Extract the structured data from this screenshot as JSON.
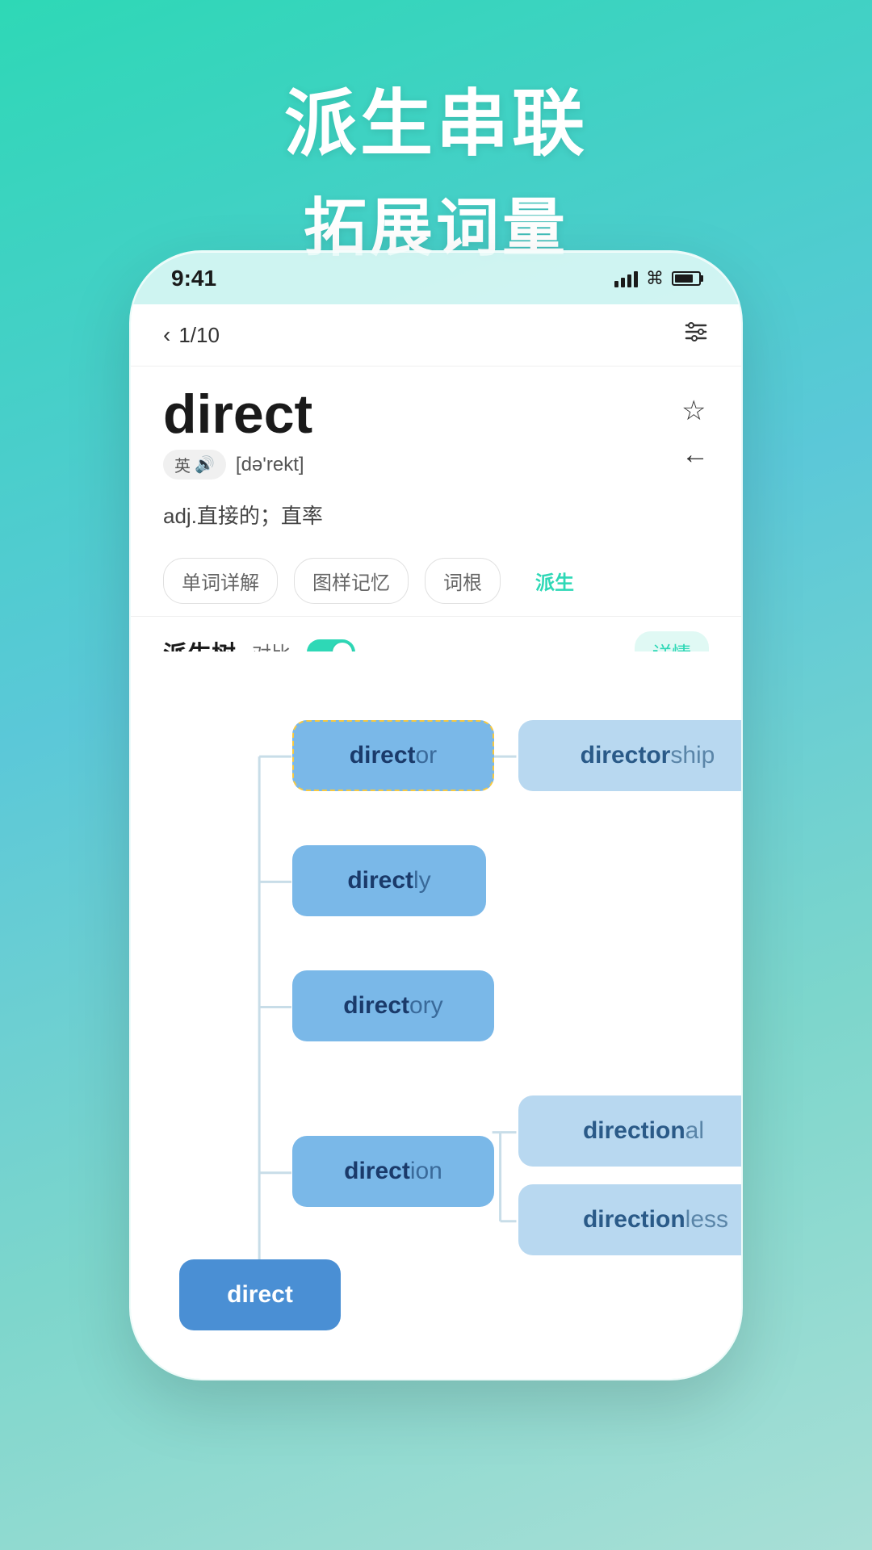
{
  "hero": {
    "line1": "派生串联",
    "line2": "拓展词量"
  },
  "status_bar": {
    "time": "9:41",
    "page": "1/10"
  },
  "word": {
    "title": "direct",
    "lang": "英",
    "phonetic": "[də'rekt]",
    "definition": "adj.直接的；直率",
    "tabs": [
      "单词详解",
      "图样记忆",
      "词根",
      "派生"
    ],
    "active_tab": "派生"
  },
  "tree": {
    "title": "派生树",
    "compare_label": "对比",
    "detail_label": "详情",
    "nodes": {
      "root": "direct",
      "director": "director",
      "directorship": "directorship",
      "directly": "directly",
      "directory": "directory",
      "direction": "direction",
      "directional": "directional",
      "directionless": "directionless"
    }
  },
  "icons": {
    "back": "←",
    "chevron": "‹",
    "star": "☆",
    "filter": "⊟",
    "speaker": "♪"
  }
}
